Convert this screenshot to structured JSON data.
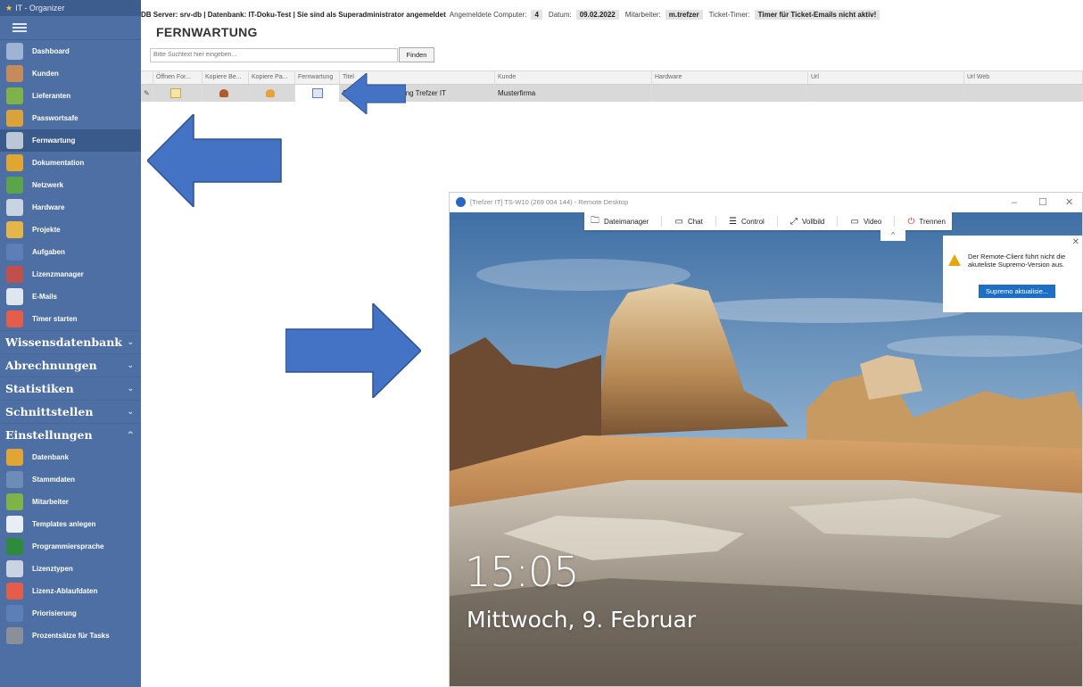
{
  "app": {
    "title": "IT - Organizer"
  },
  "sidebar": {
    "items": [
      {
        "label": "Dashboard",
        "icon": "dashboard-icon",
        "color": "#9fb4d4"
      },
      {
        "label": "Kunden",
        "icon": "customer-icon",
        "color": "#c58b5a"
      },
      {
        "label": "Lieferanten",
        "icon": "supplier-icon",
        "color": "#7fb34a"
      },
      {
        "label": "Passwortsafe",
        "icon": "password-safe-icon",
        "color": "#d9a23a"
      },
      {
        "label": "Fernwartung",
        "icon": "remote-maintenance-icon",
        "color": "#bcc7d6",
        "active": true
      },
      {
        "label": "Dokumentation",
        "icon": "documentation-icon",
        "color": "#e0a532"
      },
      {
        "label": "Netzwerk",
        "icon": "network-icon",
        "color": "#5aa54a"
      },
      {
        "label": "Hardware",
        "icon": "hardware-icon",
        "color": "#c9d3e2"
      },
      {
        "label": "Projekte",
        "icon": "projects-icon",
        "color": "#e3b54a"
      },
      {
        "label": "Aufgaben",
        "icon": "tasks-icon",
        "color": "#5c7fb8"
      },
      {
        "label": "Lizenzmanager",
        "icon": "license-manager-icon",
        "color": "#c0504d"
      },
      {
        "label": "E-Mails",
        "icon": "email-icon",
        "color": "#dfe6f0"
      },
      {
        "label": "Timer starten",
        "icon": "timer-icon",
        "color": "#e35d4a"
      }
    ],
    "sections": [
      {
        "label": "Wissensdatenbank",
        "chevron": "⌄"
      },
      {
        "label": "Abrechnungen",
        "chevron": "⌄"
      },
      {
        "label": "Statistiken",
        "chevron": "⌄"
      },
      {
        "label": "Schnittstellen",
        "chevron": "⌄"
      },
      {
        "label": "Einstellungen",
        "chevron": "^"
      }
    ],
    "settings_items": [
      {
        "label": "Datenbank",
        "icon": "database-icon",
        "color": "#e0a532"
      },
      {
        "label": "Stammdaten",
        "icon": "home-icon",
        "color": "#6e8cb8"
      },
      {
        "label": "Mitarbeiter",
        "icon": "employees-icon",
        "color": "#7fb34a"
      },
      {
        "label": "Templates anlegen",
        "icon": "template-icon",
        "color": "#e9eef5"
      },
      {
        "label": "Programmiersprache",
        "icon": "code-icon",
        "color": "#2f8a3b"
      },
      {
        "label": "Lizenztypen",
        "icon": "license-type-icon",
        "color": "#c9d3e2"
      },
      {
        "label": "Lizenz-Ablaufdaten",
        "icon": "timer-icon",
        "color": "#e35d4a"
      },
      {
        "label": "Priorisierung",
        "icon": "priority-icon",
        "color": "#5c7fb8"
      },
      {
        "label": "Prozentsätze für Tasks",
        "icon": "percent-icon",
        "color": "#8a8f99"
      }
    ]
  },
  "topbar": {
    "server": "DB Server: srv-db | Datenbank: IT-Doku-Test | Sie sind als Superadministrator angemeldet",
    "computers_label": "Angemeldete Computer:",
    "computers_value": "4",
    "date_label": "Datum:",
    "date_value": "09.02.2022",
    "employee_label": "Mitarbeiter:",
    "employee_value": "m.trefzer",
    "timer_label": "Ticket-Timer:",
    "timer_value": "Timer für Ticket-Emails nicht aktiv!"
  },
  "page": {
    "title": "FERNWARTUNG"
  },
  "search": {
    "placeholder": "Bitte Suchtext hier eingeben...",
    "button": "Finden"
  },
  "grid": {
    "columns": [
      "Öffnen For...",
      "Kopiere Be...",
      "Kopiere Pa...",
      "Fernwartung",
      "Titel",
      "Kunde",
      "Hardware",
      "Url",
      "Url Web"
    ],
    "rows": [
      {
        "title": "Supremo Fernwartung Trefzer IT",
        "customer": "Musterfirma"
      }
    ]
  },
  "remote": {
    "window_title": "[Trefzer IT] TS-W10 (269 004 144) - Remote Desktop",
    "toolbar": [
      "Dateimanager",
      "Chat",
      "Control",
      "Vollbild",
      "Video",
      "Trennen"
    ],
    "notification": {
      "message": "Der Remote-Client führt nicht die akuteliste Supremo-Version aus.",
      "button": "Supremo aktualisie..."
    },
    "time": "15:05",
    "date": "Mittwoch, 9. Februar"
  },
  "colors": {
    "sidebar": "#4d6fa3",
    "arrow": "#4472c4",
    "accent_button": "#1d6fc6"
  }
}
